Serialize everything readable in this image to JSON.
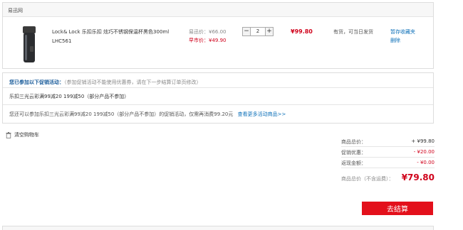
{
  "shop": {
    "name": "易迅网"
  },
  "item": {
    "title": "Lock& Lock 乐扣乐扣 炫巧不锈钢保温杯黑色300ml LHC561",
    "orig_label": "易迅价：",
    "orig_price": "¥66.00",
    "sale_label": "早市价：",
    "sale_price": "¥49.90",
    "qty": "2",
    "minus": "−",
    "plus": "+",
    "subtotal": "¥99.80",
    "stock": "有货，可当日发货",
    "save_label": "暂存收藏夹",
    "delete_label": "删除"
  },
  "promo": {
    "title": "您已参加以下促销活动：",
    "note": "（参加促销活动不能使用优惠券，请在下一步结算订单页修改）",
    "line1": "乐扣三光云彩满99减20 199减50（部分产品不参加）",
    "line2": "您还可以参加乐扣三光云彩满99减20 199减50（部分产品不参加）的促销活动，仅需再消费99.20元",
    "more_link": "查看更多活动商品>>"
  },
  "cart": {
    "clear_label": "清空购物车"
  },
  "summary": {
    "goods_label": "商品总价：",
    "goods_value": "+ ¥99.80",
    "promo_label": "促销优惠：",
    "promo_value": "- ¥20.00",
    "return_label": "返现金额：",
    "return_value": "- ¥0.00",
    "total_label": "商品总价（不含运费）：",
    "total_value": "¥79.80"
  },
  "checkout": {
    "label": "去结算"
  },
  "colors": {
    "accent_red": "#e3101b",
    "price_red": "#d0021b",
    "link_blue": "#0b6fb8"
  }
}
